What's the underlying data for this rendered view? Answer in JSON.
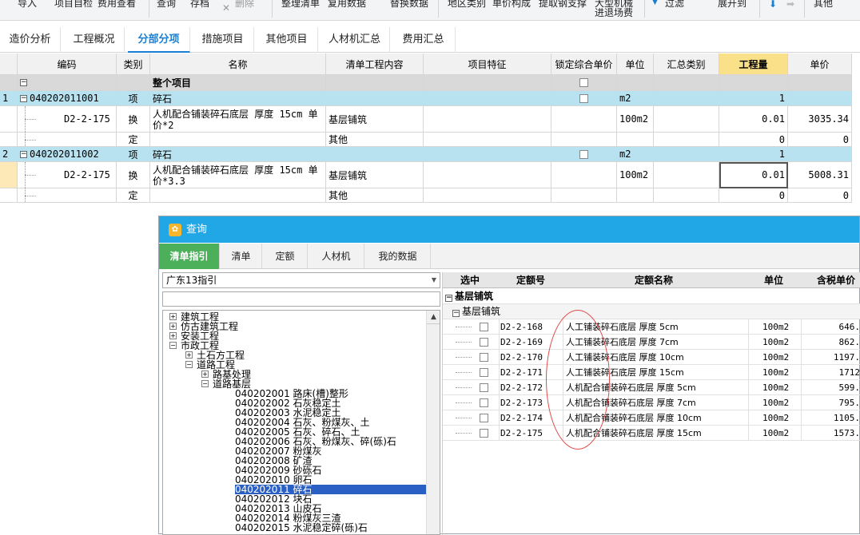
{
  "toolbar": {
    "items": [
      "导入",
      "项目自检",
      "费用查看",
      "查询",
      "存档",
      "删除",
      "整理清单",
      "复用数据",
      "替换数据",
      "地区类别",
      "单价构成",
      "提取钢支撑",
      "大型机械",
      "进退场费",
      "过滤",
      "展开到",
      "其他"
    ]
  },
  "tabs": [
    "造价分析",
    "工程概况",
    "分部分项",
    "措施项目",
    "其他项目",
    "人材机汇总",
    "费用汇总"
  ],
  "grid": {
    "headers": [
      "编码",
      "类别",
      "名称",
      "清单工程内容",
      "项目特征",
      "锁定综合单价",
      "单位",
      "汇总类别",
      "工程量",
      "单价"
    ],
    "rows": [
      {
        "no": "",
        "code": "",
        "type": "",
        "name": "整个项目",
        "content": "",
        "unit": "",
        "qty": "",
        "price": "",
        "style": "top"
      },
      {
        "no": "1",
        "code": "040202011001",
        "type": "项",
        "name": "碎石",
        "content": "",
        "unit": "m2",
        "qty": "1",
        "price": "",
        "style": "sel"
      },
      {
        "no": "",
        "code": "D2-2-175 *2",
        "type": "换",
        "name": "人机配合铺装碎石底层 厚度 15cm  单价*2",
        "content": "基层铺筑",
        "unit": "100m2",
        "qty": "0.01",
        "price": "3035.34",
        "style": "tall"
      },
      {
        "no": "",
        "code": "",
        "type": "定",
        "name": "",
        "content": "其他",
        "unit": "",
        "qty": "0",
        "price": "0",
        "style": "plain"
      },
      {
        "no": "2",
        "code": "040202011002",
        "type": "项",
        "name": "碎石",
        "content": "",
        "unit": "m2",
        "qty": "1",
        "price": "",
        "style": "sel"
      },
      {
        "no": "",
        "code": "D2-2-175 *3.3",
        "type": "换",
        "name": "人机配合铺装碎石底层 厚度 15cm  单价*3.3",
        "content": "基层铺筑",
        "unit": "100m2",
        "qty": "0.01",
        "price": "5008.31",
        "style": "tall"
      },
      {
        "no": "",
        "code": "",
        "type": "定",
        "name": "",
        "content": "其他",
        "unit": "",
        "qty": "0",
        "price": "0",
        "style": "plain"
      }
    ]
  },
  "dialog": {
    "title": "查询",
    "tabs": [
      "清单指引",
      "清单",
      "定额",
      "人材机",
      "我的数据"
    ],
    "combo_value": "广东13指引",
    "tree": [
      {
        "label": "建筑工程",
        "level": 0,
        "exp": "+"
      },
      {
        "label": "仿古建筑工程",
        "level": 0,
        "exp": "+"
      },
      {
        "label": "安装工程",
        "level": 0,
        "exp": "+"
      },
      {
        "label": "市政工程",
        "level": 0,
        "exp": "-"
      },
      {
        "label": "土石方工程",
        "level": 1,
        "exp": "+"
      },
      {
        "label": "道路工程",
        "level": 1,
        "exp": "-"
      },
      {
        "label": "路基处理",
        "level": 2,
        "exp": "+"
      },
      {
        "label": "道路基层",
        "level": 2,
        "exp": "-"
      },
      {
        "label": "040202001  路床(槽)整形",
        "level": 3
      },
      {
        "label": "040202002  石灰稳定土",
        "level": 3
      },
      {
        "label": "040202003  水泥稳定土",
        "level": 3
      },
      {
        "label": "040202004  石灰、粉煤灰、土",
        "level": 3
      },
      {
        "label": "040202005  石灰、碎石、土",
        "level": 3
      },
      {
        "label": "040202006  石灰、粉煤灰、碎(砾)石",
        "level": 3
      },
      {
        "label": "040202007  粉煤灰",
        "level": 3
      },
      {
        "label": "040202008  矿渣",
        "level": 3
      },
      {
        "label": "040202009  砂砾石",
        "level": 3
      },
      {
        "label": "040202010  卵石",
        "level": 3
      },
      {
        "label": "040202011  碎石",
        "level": 3,
        "selected": true
      },
      {
        "label": "040202012  块石",
        "level": 3
      },
      {
        "label": "040202013  山皮石",
        "level": 3
      },
      {
        "label": "040202014  粉煤灰三渣",
        "level": 3
      },
      {
        "label": "040202015  水泥稳定碎(砾)石",
        "level": 3
      }
    ],
    "result_headers": [
      "选中",
      "定额号",
      "定额名称",
      "单位",
      "含税单价"
    ],
    "group1": "基层铺筑",
    "group2": "基层铺筑",
    "results": [
      {
        "code": "D2-2-168",
        "name": "人工铺装碎石底层 厚度 5cm",
        "unit": "100m2",
        "price": "646."
      },
      {
        "code": "D2-2-169",
        "name": "人工铺装碎石底层 厚度 7cm",
        "unit": "100m2",
        "price": "862."
      },
      {
        "code": "D2-2-170",
        "name": "人工铺装碎石底层 厚度 10cm",
        "unit": "100m2",
        "price": "1197."
      },
      {
        "code": "D2-2-171",
        "name": "人工铺装碎石底层 厚度 15cm",
        "unit": "100m2",
        "price": "1712"
      },
      {
        "code": "D2-2-172",
        "name": "人机配合铺装碎石底层 厚度 5cm",
        "unit": "100m2",
        "price": "599."
      },
      {
        "code": "D2-2-173",
        "name": "人机配合铺装碎石底层 厚度 7cm",
        "unit": "100m2",
        "price": "795."
      },
      {
        "code": "D2-2-174",
        "name": "人机配合铺装碎石底层 厚度 10cm",
        "unit": "100m2",
        "price": "1105."
      },
      {
        "code": "D2-2-175",
        "name": "人机配合铺装碎石底层 厚度 15cm",
        "unit": "100m2",
        "price": "1573."
      }
    ]
  },
  "colors": {
    "accent": "#1a7fd0",
    "dialog_title": "#22a7e6",
    "active_tab_green": "#4cb05a",
    "selected_row": "#b8e2f0",
    "annotation": "#e04a4a"
  }
}
